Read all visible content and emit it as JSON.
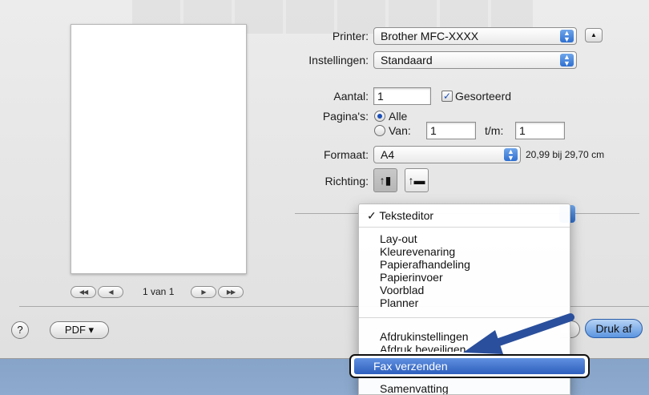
{
  "printer": {
    "label": "Printer:",
    "value": "Brother MFC-XXXX"
  },
  "settings": {
    "label": "Instellingen:",
    "value": "Standaard"
  },
  "copies": {
    "label": "Aantal:",
    "value": "1",
    "collated_label": "Gesorteerd",
    "collated_checked": true
  },
  "pages": {
    "label": "Pagina's:",
    "all_label": "Alle",
    "from_label": "Van:",
    "from_value": "1",
    "to_label": "t/m:",
    "to_value": "1"
  },
  "paper": {
    "label": "Formaat:",
    "value": "A4",
    "size_text": "20,99 bij 29,70 cm"
  },
  "orientation": {
    "label": "Richting:",
    "portrait_icon": "portrait-icon",
    "landscape_icon": "landscape-icon"
  },
  "preview": {
    "page_text": "1 van 1"
  },
  "bottom": {
    "help": "?",
    "pdf_label": "PDF ▾",
    "print_label": "Druk af"
  },
  "menu": {
    "checked_item": "Teksteditor",
    "check_mark": "✓",
    "group1": [
      "Lay-out",
      "Kleurevenaring",
      "Papierafhandeling",
      "Papierinvoer",
      "Voorblad",
      "Planner"
    ],
    "group2": [
      "Afdrukinstellingen",
      "Afdruk beveiligen"
    ],
    "highlighted": "Fax verzenden",
    "last": "Samenvatting"
  },
  "colors": {
    "accent": "#2e5fbd",
    "arrow": "#2a4f9c",
    "background": "#6e8fb6"
  }
}
